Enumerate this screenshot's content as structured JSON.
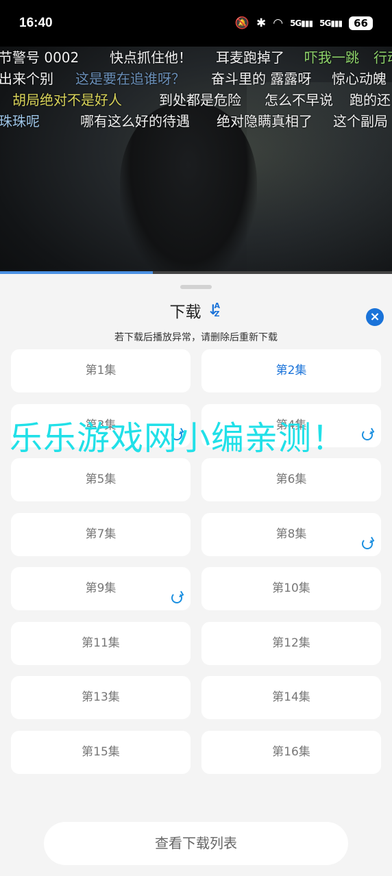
{
  "status_bar": {
    "time": "16:40",
    "battery": "66",
    "signal_1": "5G",
    "signal_2": "5G"
  },
  "danmaku": [
    {
      "text": "节警号 0002",
      "color": "#f1f1f1"
    },
    {
      "text": "快点抓住他！",
      "color": "#f1f1f1"
    },
    {
      "text": "耳麦跑掉了",
      "color": "#f1f1f1"
    },
    {
      "text": "吓我一跳",
      "color": "#8fd46b"
    },
    {
      "text": "行动",
      "color": "#8fd46b"
    },
    {
      "text": "出来个别",
      "color": "#f1f1f1"
    },
    {
      "text": "这是要在追谁呀？",
      "color": "#6a8fb8"
    },
    {
      "text": "奋斗里的 露露呀",
      "color": "#f1f1f1"
    },
    {
      "text": "惊心动魄",
      "color": "#f1f1f1"
    },
    {
      "text": "胡局绝对不是好人",
      "color": "#d8d35a"
    },
    {
      "text": "到处都是危险",
      "color": "#f1f1f1"
    },
    {
      "text": "怎么不早说",
      "color": "#f1f1f1"
    },
    {
      "text": "跑的还",
      "color": "#f1f1f1"
    },
    {
      "text": "珠珠呢",
      "color": "#9fc6e8"
    },
    {
      "text": "哪有这么好的待遇",
      "color": "#f1f1f1"
    },
    {
      "text": "绝对隐瞒真相了",
      "color": "#f1f1f1"
    },
    {
      "text": "这个副局",
      "color": "#f1f1f1"
    }
  ],
  "video": {
    "progress": 0.39
  },
  "sheet": {
    "title": "下载",
    "sort_icon": "sort-az-icon",
    "close_icon": "close-icon",
    "hint": "若下载后播放异常，请删除后重新下载",
    "episodes": [
      {
        "label": "第1集",
        "active": false,
        "downloading": false
      },
      {
        "label": "第2集",
        "active": true,
        "downloading": false
      },
      {
        "label": "第3集",
        "active": false,
        "downloading": true
      },
      {
        "label": "第4集",
        "active": false,
        "downloading": true
      },
      {
        "label": "第5集",
        "active": false,
        "downloading": false
      },
      {
        "label": "第6集",
        "active": false,
        "downloading": false
      },
      {
        "label": "第7集",
        "active": false,
        "downloading": false
      },
      {
        "label": "第8集",
        "active": false,
        "downloading": true
      },
      {
        "label": "第9集",
        "active": false,
        "downloading": true
      },
      {
        "label": "第10集",
        "active": false,
        "downloading": false
      },
      {
        "label": "第11集",
        "active": false,
        "downloading": false
      },
      {
        "label": "第12集",
        "active": false,
        "downloading": false
      },
      {
        "label": "第13集",
        "active": false,
        "downloading": false
      },
      {
        "label": "第14集",
        "active": false,
        "downloading": false
      },
      {
        "label": "第15集",
        "active": false,
        "downloading": false
      },
      {
        "label": "第16集",
        "active": false,
        "downloading": false
      }
    ],
    "list_button": "查看下载列表"
  },
  "watermark": "乐乐游戏网小编亲测！",
  "colors": {
    "accent": "#1a73d9",
    "watermark": "#21e0e8"
  }
}
